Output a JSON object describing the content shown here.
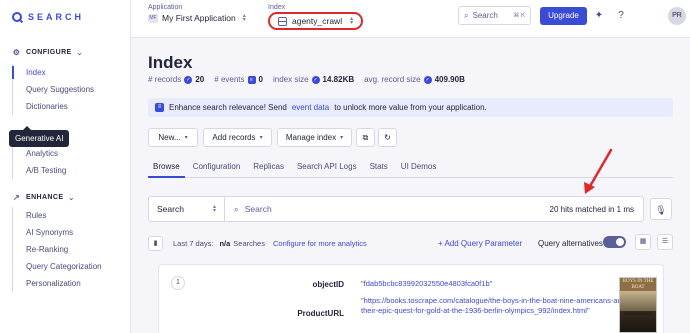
{
  "brand": {
    "logo_text": "SEARCH"
  },
  "sidebar": {
    "configure": {
      "label": "CONFIGURE",
      "items": [
        "Index",
        "Query Suggestions",
        "Dictionaries"
      ]
    },
    "tooltip": "Generative AI",
    "observe": {
      "items": [
        "Analytics",
        "A/B Testing"
      ]
    },
    "enhance": {
      "label": "ENHANCE",
      "items": [
        "Rules",
        "AI Synonyms",
        "Re-Ranking",
        "Query Categorization",
        "Personalization"
      ]
    }
  },
  "topbar": {
    "application_label": "Application",
    "application_badge": "MF",
    "application_name": "My First Application",
    "index_label": "Index",
    "index_name": "agenty_crawl",
    "search_placeholder": "Search",
    "search_shortcut": "⌘ K",
    "upgrade_label": "Upgrade",
    "avatar_initials": "PR"
  },
  "page": {
    "title": "Index",
    "stats": [
      {
        "label": "# records",
        "value": "20"
      },
      {
        "label": "# events",
        "value": "0"
      },
      {
        "label": "index size",
        "value": "14.82KB"
      },
      {
        "label": "avg. record size",
        "value": "409.90B"
      }
    ],
    "banner": {
      "pre": "Enhance search relevance! Send",
      "link": "event data",
      "post": "to unlock more value from your application."
    }
  },
  "actions": {
    "new": "New...",
    "add_records": "Add records",
    "manage_index": "Manage index"
  },
  "tabs": [
    "Browse",
    "Configuration",
    "Replicas",
    "Search API Logs",
    "Stats",
    "UI Demos"
  ],
  "search": {
    "type": "Search",
    "placeholder": "Search",
    "hits_text": "20 hits matched in 1 ms"
  },
  "analytics": {
    "period": "Last 7 days:",
    "value": "n/a",
    "searches": "Searches",
    "configure_link": "Configure for more analytics",
    "add_query_param": "+ Add Query Parameter",
    "query_alternatives": "Query alternatives"
  },
  "record": {
    "number": "1",
    "fields": [
      {
        "key": "objectID",
        "value": "\"fdab5bcbc83992032550e4803fca0f1b\""
      },
      {
        "key": "ProductURL",
        "value": "\"https://books.toscrape.com/catalogue/the-boys-in-the-boat-nine-americans-and-their-epic-quest-for-gold-at-the-1936-berlin-olympics_992/index.html\""
      }
    ],
    "thumbnail_title": "BOYS IN THE BOAT"
  },
  "colors": {
    "accent": "#3a4bd6",
    "annotation_red": "#e0282c"
  }
}
